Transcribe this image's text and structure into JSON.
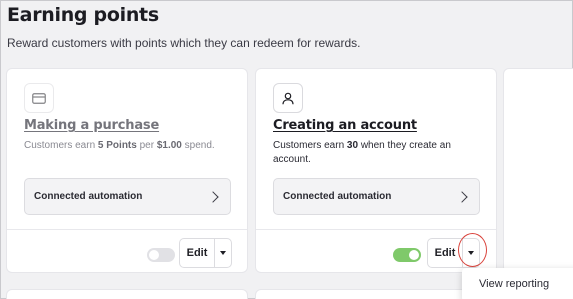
{
  "page": {
    "title": "Earning points",
    "subtitle": "Reward customers with points which they can redeem for rewards."
  },
  "cards": [
    {
      "icon": "credit-card-icon",
      "title": "Making a purchase",
      "desc_prefix": "Customers earn ",
      "desc_bold1": "5 Points",
      "desc_mid": " per ",
      "desc_bold2": "$1.00",
      "desc_suffix": " spend.",
      "automation_label": "Connected automation",
      "enabled": false,
      "edit_label": "Edit"
    },
    {
      "icon": "user-icon",
      "title": "Creating an account",
      "desc_prefix": "Customers earn ",
      "desc_bold1": "30",
      "desc_suffix": " when they create an account.",
      "automation_label": "Connected automation",
      "enabled": true,
      "edit_label": "Edit"
    }
  ],
  "dropdown_menu": {
    "items": [
      "View reporting"
    ]
  },
  "colors": {
    "toggle_on": "#7fc96a",
    "toggle_off": "#e1e1e5",
    "highlight": "#d9433c"
  }
}
